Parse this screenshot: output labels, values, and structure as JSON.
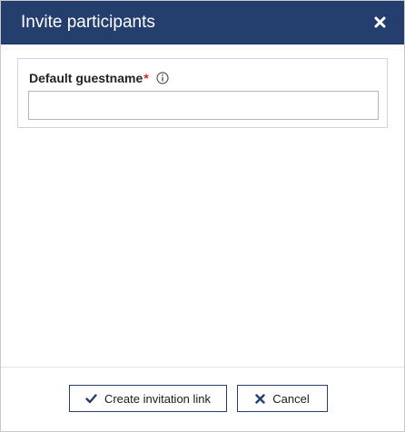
{
  "dialog": {
    "title": "Invite participants",
    "close_icon": "close-icon"
  },
  "form": {
    "guestname": {
      "label": "Default guestname",
      "required_marker": "*",
      "info_icon": "info-circle-icon",
      "value": "",
      "placeholder": ""
    }
  },
  "footer": {
    "create_label": "Create invitation link",
    "create_icon": "check-icon",
    "cancel_label": "Cancel",
    "cancel_icon": "close-icon"
  },
  "colors": {
    "titlebar": "#243e6e",
    "required": "#d0262e",
    "button_border": "#243e6e"
  }
}
